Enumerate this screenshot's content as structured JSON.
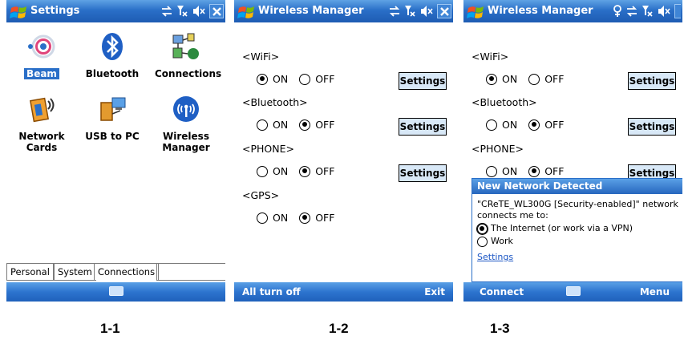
{
  "screen1": {
    "title": "Settings",
    "apps": [
      {
        "label": "Beam",
        "icon": "beam-icon"
      },
      {
        "label": "Bluetooth",
        "icon": "bluetooth-icon"
      },
      {
        "label": "Connections",
        "icon": "connections-icon"
      },
      {
        "label_line1": "Network",
        "label_line2": "Cards",
        "icon": "network-cards-icon"
      },
      {
        "label": "USB to PC",
        "icon": "usb-to-pc-icon"
      },
      {
        "label_line1": "Wireless",
        "label_line2": "Manager",
        "icon": "wireless-manager-icon"
      }
    ],
    "tabs": [
      "Personal",
      "System",
      "Connections"
    ]
  },
  "screen2": {
    "title": "Wireless Manager",
    "sections": [
      {
        "label": "<WiFi>",
        "on": "ON",
        "off": "OFF",
        "selected": "on",
        "settings": "Settings"
      },
      {
        "label": "<Bluetooth>",
        "on": "ON",
        "off": "OFF",
        "selected": "off",
        "settings": "Settings"
      },
      {
        "label": "<PHONE>",
        "on": "ON",
        "off": "OFF",
        "selected": "off",
        "settings": "Settings"
      },
      {
        "label": "<GPS>",
        "on": "ON",
        "off": "OFF",
        "selected": "off"
      }
    ],
    "soft_left": "All turn off",
    "soft_right": "Exit"
  },
  "screen3": {
    "title": "Wireless Manager",
    "sections": [
      {
        "label": "<WiFi>",
        "on": "ON",
        "off": "OFF",
        "selected": "on",
        "settings": "Settings"
      },
      {
        "label": "<Bluetooth>",
        "on": "ON",
        "off": "OFF",
        "selected": "off",
        "settings": "Settings"
      },
      {
        "label": "<PHONE>",
        "on": "ON",
        "off": "OFF",
        "selected": "off",
        "settings": "Settings"
      }
    ],
    "dialog": {
      "title": "New Network Detected",
      "message": "\"CReTE_WL300G [Security-enabled]\" network connects me to:",
      "option1": "The Internet (or work via a VPN)",
      "option2": "Work",
      "link": "Settings"
    },
    "soft_left": "Connect",
    "soft_right": "Menu"
  },
  "captions": [
    "1-1",
    "1-2",
    "1-3"
  ],
  "colors": {
    "titlebar": "#2a6fc8",
    "button_bg": "#d8e8f7",
    "link": "#1a55c4"
  }
}
